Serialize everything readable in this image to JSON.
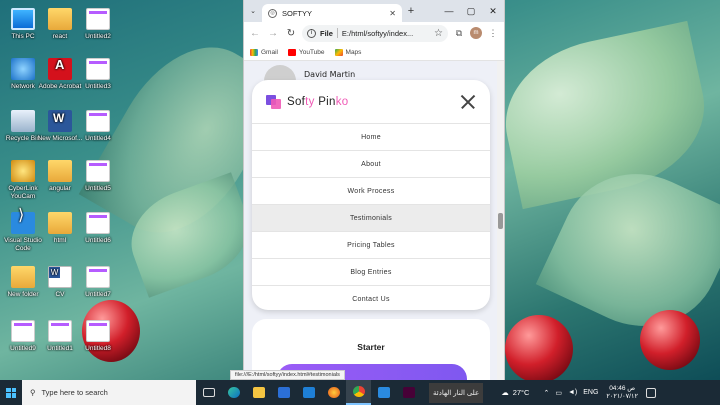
{
  "desktop": {
    "icons": [
      {
        "label": "This PC",
        "icon": "pc-icon"
      },
      {
        "label": "react",
        "icon": "folder-icon"
      },
      {
        "label": "Untitled2",
        "icon": "image-file-icon"
      },
      {
        "label": "Network",
        "icon": "network-icon"
      },
      {
        "label": "Adobe Acrobat",
        "icon": "acrobat-icon"
      },
      {
        "label": "Untitled3",
        "icon": "image-file-icon"
      },
      {
        "label": "Recycle Bin",
        "icon": "recycle-bin-icon"
      },
      {
        "label": "New Microsof...",
        "icon": "word-icon"
      },
      {
        "label": "Untitled4",
        "icon": "image-file-icon"
      },
      {
        "label": "CyberLink YouCam",
        "icon": "youcam-icon"
      },
      {
        "label": "angular",
        "icon": "folder-icon"
      },
      {
        "label": "Untitled5",
        "icon": "image-file-icon"
      },
      {
        "label": "Visual Studio Code",
        "icon": "vscode-icon"
      },
      {
        "label": "html",
        "icon": "folder-icon"
      },
      {
        "label": "Untitled6",
        "icon": "image-file-icon"
      },
      {
        "label": "New folder",
        "icon": "folder-icon"
      },
      {
        "label": "CV",
        "icon": "word-doc-icon"
      },
      {
        "label": "Untitled7",
        "icon": "image-file-icon"
      },
      {
        "label": "Untitled9",
        "icon": "image-file-icon"
      },
      {
        "label": "Untitled1",
        "icon": "image-file-icon"
      },
      {
        "label": "Untitled8",
        "icon": "image-file-icon"
      }
    ]
  },
  "browser": {
    "tab_title": "SOFTYY",
    "address_protocol": "File",
    "address_url": "E:/html/softyy/index...",
    "bookmarks": [
      "Gmail",
      "YouTube",
      "Maps"
    ],
    "profile_initial": "m",
    "status_url": "file:///E:/html/softyy/index.html#testimonials"
  },
  "page": {
    "behind_author_name": "David Martin",
    "logo": {
      "part1": "Sof",
      "part2": "ty",
      "part3": " Pin",
      "part4": "ko"
    },
    "menu_items": [
      "Home",
      "About",
      "Work Process",
      "Testimonials",
      "Pricing Tables",
      "Blog Entries",
      "Contact Us"
    ],
    "active_menu_index": 3,
    "pricing_title": "Starter"
  },
  "taskbar": {
    "search_placeholder": "Type here to search",
    "news_text": "على النار الهادئة",
    "temperature": "27°C",
    "language": "ENG",
    "time": "04:46 ص",
    "date": "٢٠٢١/٠٧/١٢"
  },
  "colors": {
    "brand_purple": "#7b4fe0",
    "brand_pink": "#f05ab6",
    "taskbar": "#1b2a36"
  }
}
